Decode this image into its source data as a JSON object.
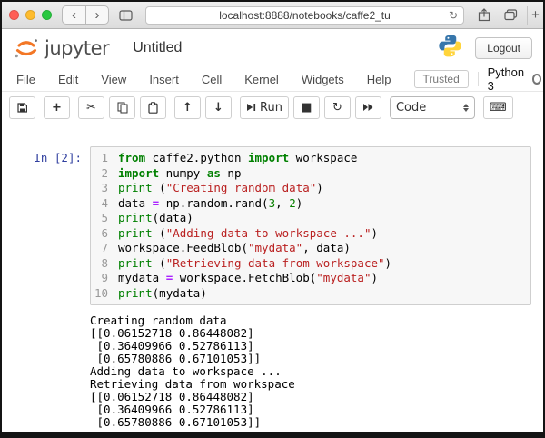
{
  "browser": {
    "url": "localhost:8888/notebooks/caffe2_tu",
    "back_glyph": "‹",
    "forward_glyph": "›",
    "reload_glyph": "↻",
    "newtab_glyph": "+"
  },
  "header": {
    "brand": "jupyter",
    "title": "Untitled",
    "logout_label": "Logout"
  },
  "menubar": {
    "items": [
      "File",
      "Edit",
      "View",
      "Insert",
      "Cell",
      "Kernel",
      "Widgets",
      "Help"
    ],
    "trusted_label": "Trusted",
    "kernel_name": "Python 3"
  },
  "toolbar": {
    "run_label": "Run",
    "cell_type": "Code",
    "icons": {
      "add": "+",
      "cut": "✂",
      "move_up": "↑",
      "move_down": "↓",
      "stop": "■",
      "restart": "↻",
      "keyboard": "⌨"
    }
  },
  "colors": {
    "prompt": "#303F9F",
    "keyword": "#008000",
    "builtin": "#008000",
    "string": "#BA2121",
    "number": "#088000",
    "operator": "#AA22FF",
    "jupyter_orange": "#F37726",
    "python_blue": "#3776AB",
    "python_yellow": "#FFD43B"
  },
  "cell": {
    "prompt": "In [2]:",
    "code": [
      [
        [
          "kw",
          "from"
        ],
        [
          "t",
          " caffe2.python "
        ],
        [
          "kw",
          "import"
        ],
        [
          "t",
          " workspace"
        ]
      ],
      [
        [
          "kw",
          "import"
        ],
        [
          "t",
          " numpy "
        ],
        [
          "kw",
          "as"
        ],
        [
          "t",
          " np"
        ]
      ],
      [
        [
          "bi",
          "print"
        ],
        [
          "t",
          " ("
        ],
        [
          "s",
          "\"Creating random data\""
        ],
        [
          "t",
          ")"
        ]
      ],
      [
        [
          "t",
          "data "
        ],
        [
          "o",
          "="
        ],
        [
          "t",
          " np.random.rand("
        ],
        [
          "n",
          "3"
        ],
        [
          "t",
          ", "
        ],
        [
          "n",
          "2"
        ],
        [
          "t",
          ")"
        ]
      ],
      [
        [
          "bi",
          "print"
        ],
        [
          "t",
          "(data)"
        ]
      ],
      [
        [
          "bi",
          "print"
        ],
        [
          "t",
          " ("
        ],
        [
          "s",
          "\"Adding data to workspace ...\""
        ],
        [
          "t",
          ")"
        ]
      ],
      [
        [
          "t",
          "workspace.FeedBlob("
        ],
        [
          "s",
          "\"mydata\""
        ],
        [
          "t",
          ", data)"
        ]
      ],
      [
        [
          "bi",
          "print"
        ],
        [
          "t",
          " ("
        ],
        [
          "s",
          "\"Retrieving data from workspace\""
        ],
        [
          "t",
          ")"
        ]
      ],
      [
        [
          "t",
          "mydata "
        ],
        [
          "o",
          "="
        ],
        [
          "t",
          " workspace.FetchBlob("
        ],
        [
          "s",
          "\"mydata\""
        ],
        [
          "t",
          ")"
        ]
      ],
      [
        [
          "bi",
          "print"
        ],
        [
          "t",
          "(mydata)"
        ]
      ]
    ],
    "output": [
      "Creating random data",
      "[[0.06152718 0.86448082]",
      " [0.36409966 0.52786113]",
      " [0.65780886 0.67101053]]",
      "Adding data to workspace ...",
      "Retrieving data from workspace",
      "[[0.06152718 0.86448082]",
      " [0.36409966 0.52786113]",
      " [0.65780886 0.67101053]]"
    ]
  }
}
